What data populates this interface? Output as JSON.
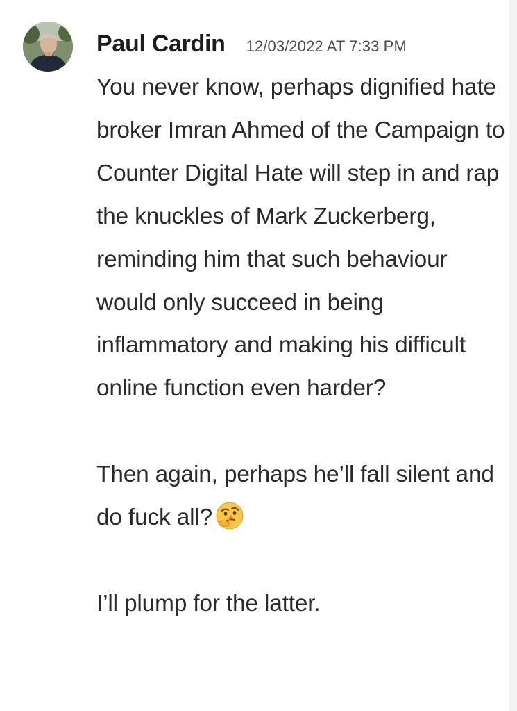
{
  "comment": {
    "author": "Paul Cardin",
    "timestamp": "12/03/2022 AT 7:33 PM",
    "avatar_icon": "user-photo-avatar",
    "paragraphs": [
      "You never know, perhaps dignified hate broker Imran Ahmed of the Campaign to Counter Digital Hate will step in and rap the knuckles of Mark Zuckerberg, reminding him that such behaviour would only succeed in being inflammatory and making his difficult online function even harder?",
      "Then again, perhaps he’ll fall silent and do fuck all?",
      "I’ll plump for the latter."
    ],
    "emoji": "thinking-face-emoji"
  },
  "colors": {
    "author": "#1c1c1c",
    "timestamp": "#4d4d4d",
    "body": "#2a2a2a",
    "background": "#ffffff"
  }
}
